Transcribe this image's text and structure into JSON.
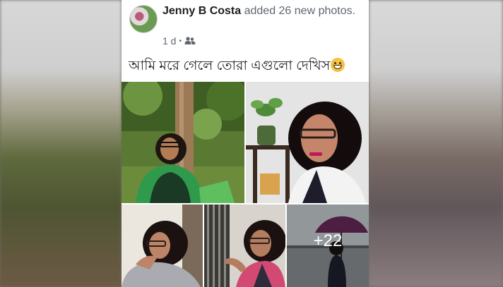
{
  "post": {
    "author": "Jenny B Costa",
    "action_text": "added 26 new photos.",
    "time": "1 d",
    "separator": "•",
    "audience_icon": "friends-icon",
    "caption": "আমি মরে গেলে তোরা এগুলো দেখিস",
    "caption_emoji": "grinning-face-emoji",
    "more_photos_label": "+22"
  },
  "colors": {
    "name": "#1c1e21",
    "meta": "#606770",
    "background": "#ffffff"
  }
}
